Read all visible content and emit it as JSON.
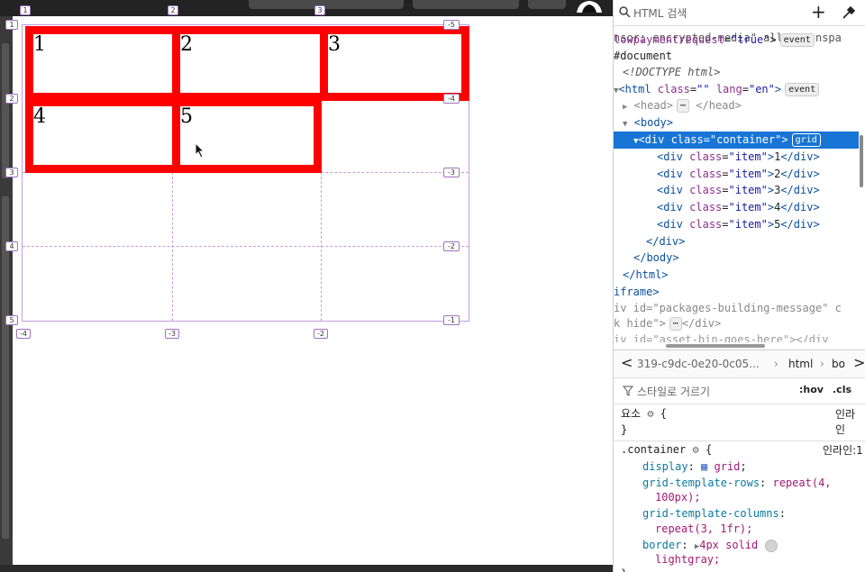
{
  "devtools": {
    "search_placeholder": "HTML 검색",
    "html_lines": {
      "l1": "nsor; encrypted-media\" allowtranspa",
      "l2_attr": "lowpaymentrequest",
      "l2_val": "\"true\"",
      "l2_event": "event",
      "l3": "#document",
      "l4": "<!DOCTYPE html>",
      "l5_tag": "<html",
      "l5_attr1": "class",
      "l5_val1": "\"\"",
      "l5_attr2": "lang",
      "l5_val2": "\"en\"",
      "l5_event": "event",
      "l6": "<head>",
      "l6_dots": "⋯",
      "l6_close": "</head>",
      "l7": "<body>",
      "l8_tag": "<div",
      "l8_attr": "class",
      "l8_val": "\"container\"",
      "l8_badge": "grid",
      "items": [
        {
          "num": "1"
        },
        {
          "num": "2"
        },
        {
          "num": "3"
        },
        {
          "num": "4"
        },
        {
          "num": "5"
        }
      ],
      "item_attr": "class",
      "item_val": "\"item\"",
      "close_div": "</div>",
      "close_body": "</body>",
      "close_html": "</html>",
      "iframe": "iframe>",
      "l_div_id_attr": "iv id",
      "l_div_id_val": "\"packages-building-message\"",
      "l_div_id_tail": "c",
      "l_hide": "k hide\">",
      "l_hide_dots": "⋯",
      "l_hide_close": "</div>",
      "l_last": "iv id=\"asset-bin-goes-here\"></div"
    },
    "breadcrumb": {
      "back": "<",
      "item1": "319-c9dc-0e20-0c05...",
      "sep1": "›",
      "item2": "html",
      "sep2": "›",
      "item3": "bo",
      "forward": ">"
    },
    "filter": {
      "placeholder": "스타일로 거르기",
      "hov": ":hov",
      "cls": ".cls"
    },
    "styles": {
      "element_label": "요소",
      "element_brace": "{",
      "element_source": "인라인",
      "element_close": "}",
      "selector": ".container",
      "selector_brace": "{",
      "selector_source": "인라인:1",
      "props": [
        {
          "name": "display",
          "value": "grid"
        },
        {
          "name": "grid-template-rows",
          "value": "repeat(4,"
        },
        {
          "name": "",
          "value": "100px);"
        },
        {
          "name": "grid-template-columns",
          "value": ""
        },
        {
          "name": "",
          "value": "repeat(3, 1fr);"
        },
        {
          "name": "border",
          "value": "4px solid"
        },
        {
          "name": "",
          "value": "lightgray;"
        }
      ],
      "close": "}"
    }
  },
  "preview": {
    "items": [
      "1",
      "2",
      "3",
      "4",
      "5"
    ],
    "row_badges_left": [
      "1",
      "2",
      "3",
      "4",
      "5"
    ],
    "row_badges_right": [
      "-5",
      "-4",
      "-3",
      "-2",
      "-1"
    ],
    "col_badges_top": [
      "1",
      "2",
      "3"
    ],
    "col_badges_bottom": [
      "-4",
      "-3",
      "-2"
    ],
    "grid_color": "#c89be0",
    "item_border_color": "#ff0000"
  }
}
